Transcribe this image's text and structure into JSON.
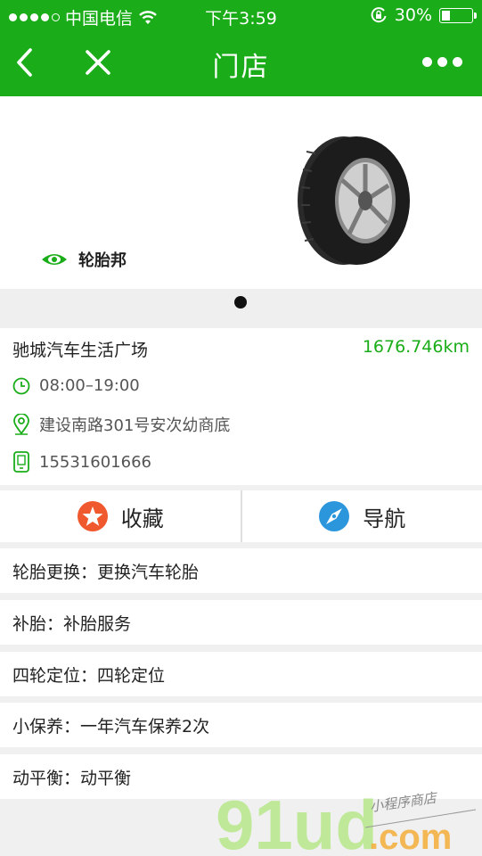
{
  "status_bar": {
    "carrier": "中国电信",
    "time": "下午3:59",
    "battery": "30%",
    "battery_level": 0.3
  },
  "nav": {
    "title": "门店"
  },
  "banner": {
    "brand": "轮胎邦",
    "carousel": {
      "pages": 1,
      "current": 1
    }
  },
  "store": {
    "name": "驰城汽车生活广场",
    "distance": "1676.746km",
    "hours": "08:00–19:00",
    "address": "建设南路301号安次幼商底",
    "phone": "15531601666"
  },
  "actions": {
    "favorite": "收藏",
    "navigate": "导航"
  },
  "services": [
    "轮胎更换：更换汽车轮胎",
    "补胎：补胎服务",
    "四轮定位：四轮定位",
    "小保养：一年汽车保养2次",
    "动平衡：动平衡"
  ],
  "watermark": {
    "logo": "91ud",
    "domain": ".com",
    "tagline": "小程序商店"
  },
  "colors": {
    "brand_green": "#1aad19",
    "favorite_orange": "#f0582d",
    "navigate_blue": "#2c96dd"
  }
}
